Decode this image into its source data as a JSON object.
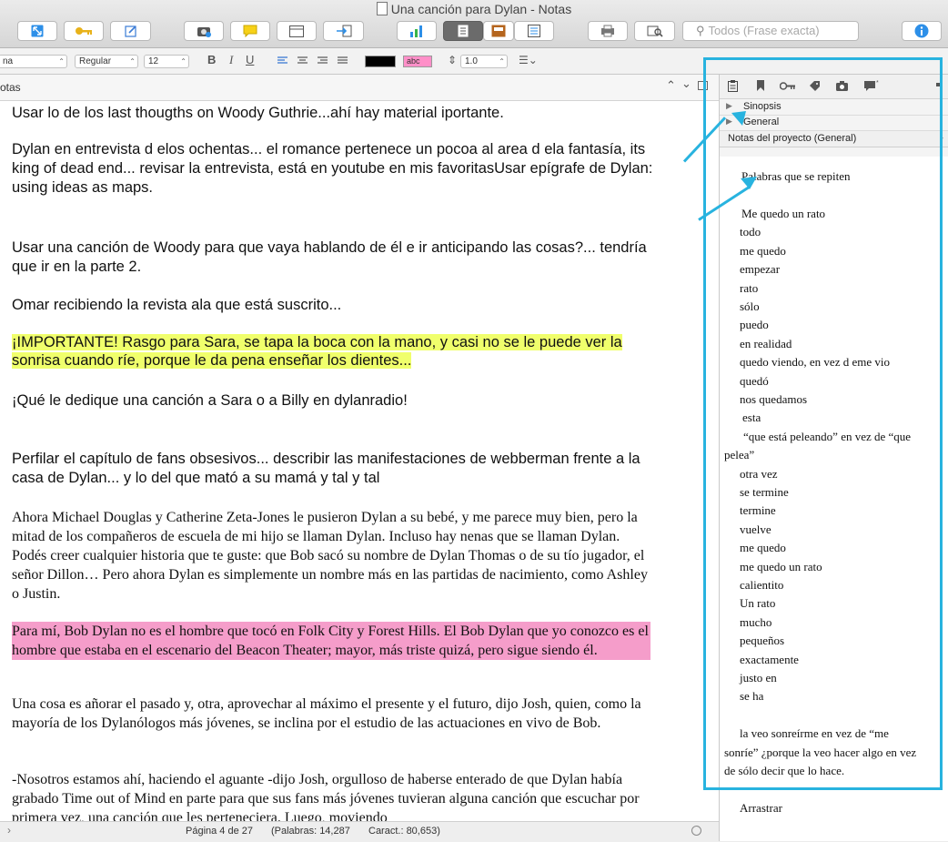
{
  "window": {
    "title": "Una canción para Dylan - Notas"
  },
  "toolbar": {
    "search_placeholder": "Todos (Frase exacta)",
    "icons": [
      "expand-icon",
      "key-icon",
      "edit-icon",
      "snapshot-icon",
      "comment-icon",
      "layout-icon",
      "import-icon",
      "chart-icon",
      "page-view-icon",
      "corkboard-icon",
      "outline-icon",
      "print-icon",
      "quick-reference-icon",
      "info-icon"
    ]
  },
  "format_bar": {
    "font_family": "na",
    "font_style": "Regular",
    "font_size": "12",
    "bold": "B",
    "italic": "I",
    "underline": "U",
    "highlight_label": "abc",
    "line_spacing": "1.0",
    "colors": {
      "text_color": "#000000",
      "highlight_color": "#ff8fc8"
    }
  },
  "header": {
    "title": "otas"
  },
  "editor": {
    "paragraphs": [
      {
        "text": "Usar lo de los last thougths on Woody Guthrie...ahí hay material iportante."
      },
      {
        "text": "Dylan en entrevista d elos ochentas... el romance pertenece un pocoa  al area d ela fantasía, its king of dead end... revisar la entrevista, está en youtube en mis favoritasUsar epígrafe de Dylan: using ideas as maps."
      },
      {
        "text": "Usar una canción de Woody para que vaya hablando de él e ir anticipando las cosas?... tendría que ir en la parte 2."
      },
      {
        "text": "Omar recibiendo la revista ala que está suscrito..."
      },
      {
        "text": "¡IMPORTANTE! Rasgo para Sara, se tapa la boca con la mano, y casi no se le puede ver la sonrisa cuando ríe, porque le da pena enseñar los dientes..."
      },
      {
        "text": "¡Qué le dedique una canción a Sara o a Billy en dylanradio!"
      },
      {
        "text": "Perfilar el capítulo de fans obsesivos...  describir las manifestaciones de webberman frente a la casa de Dylan... y lo del que mató a su mamá y tal y tal"
      },
      {
        "text": "Ahora Michael Douglas y Catherine Zeta-Jones le pusieron Dylan a su bebé, y me parece muy bien, pero la mitad de los compañeros de escuela de mi hijo se llaman Dylan. Incluso hay nenas que se llaman Dylan. Podés creer cualquier historia que te guste: que Bob sacó su nombre de Dylan Thomas o de su tío jugador, el señor Dillon… Pero ahora Dylan es simplemente un nombre más en las partidas de nacimiento, como Ashley o Justin."
      },
      {
        "text": "Para mí, Bob Dylan no es el hombre que tocó en Folk City y Forest Hills. El Bob Dylan que yo conozco es el hombre que estaba en el escenario del Beacon Theater; mayor, más triste quizá, pero sigue siendo él."
      },
      {
        "text": "Una cosa es añorar el pasado y, otra, aprovechar al máximo el presente y el futuro, dijo Josh, quien, como la mayoría de los Dylanólogos más jóvenes, se inclina por el estudio de las actuaciones en vivo de Bob."
      },
      {
        "text": "-Nosotros estamos ahí, haciendo el aguante -dijo Josh, orgulloso de haberse enterado de que Dylan había grabado Time out of Mind en parte para que sus fans más jóvenes tuvieran alguna canción que escuchar por primera vez, una canción que les perteneciera. Luego, moviendo"
      }
    ]
  },
  "footer": {
    "page": "Página 4 de 27",
    "words": "(Palabras: 14,287",
    "chars": "Caract.: 80,653)"
  },
  "inspector": {
    "tabs": [
      "notes-icon",
      "bookmark-icon",
      "key-icon",
      "tag-icon",
      "camera-icon",
      "comments-icon"
    ],
    "sections": [
      "Sinopsis",
      "General"
    ],
    "notes_title": "Notas del proyecto (General)",
    "notes_lines": [
      "Palabras que se repiten",
      "Me quedo un rato",
      "todo",
      "me quedo",
      "empezar",
      "rato",
      "sólo",
      "puedo",
      "en realidad",
      "quedo viendo,  en vez d eme vio",
      "quedó",
      "nos quedamos",
      "esta",
      "“que está  peleando” en vez de “que",
      "pelea”",
      "otra vez",
      "se termine",
      "termine",
      "vuelve",
      "me quedo",
      "me quedo un rato",
      "calientito",
      "Un rato",
      "mucho",
      "pequeños",
      "exactamente",
      "justo en",
      "se ha",
      "la veo sonreírme en vez de “me",
      "sonríe” ¿porque la veo hacer algo en vez",
      "de sólo decir que lo hace.",
      "Arrastrar"
    ]
  },
  "annotation": {
    "color": "#28b3df"
  }
}
